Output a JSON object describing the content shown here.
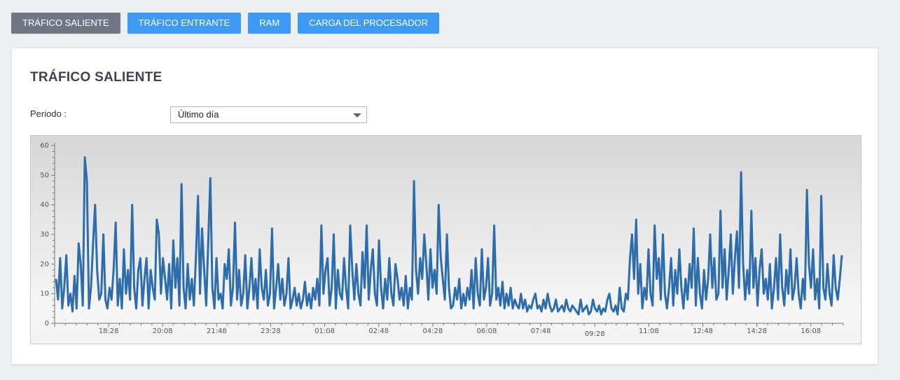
{
  "tabs": [
    {
      "label": "TRÁFICO SALIENTE",
      "active": true
    },
    {
      "label": "TRÁFICO ENTRANTE",
      "active": false
    },
    {
      "label": "RAM",
      "active": false
    },
    {
      "label": "CARGA DEL PROCESADOR",
      "active": false
    }
  ],
  "panel": {
    "title": "TRÁFICO SALIENTE",
    "period_label": "Periodo :",
    "period_value": "Último día"
  },
  "colors": {
    "accent": "#3d9bf5",
    "active_tab": "#6f7782",
    "series": "#2d6dab"
  },
  "chart_data": {
    "type": "line",
    "ylim": [
      0,
      60
    ],
    "yticks": [
      0,
      10,
      20,
      30,
      40,
      50,
      60
    ],
    "xlim": [
      0,
      1110
    ],
    "xticks": [
      {
        "label": "18:28",
        "t": 100
      },
      {
        "label": "20:08",
        "t": 200
      },
      {
        "label": "21:48",
        "t": 300
      },
      {
        "label": "23:28",
        "t": 400
      },
      {
        "label": "01:08",
        "t": 500
      },
      {
        "label": "02:48",
        "t": 600
      },
      {
        "label": "04:28",
        "t": 700
      },
      {
        "label": "06:08",
        "t": 800
      },
      {
        "label": "07:48",
        "t": 900
      },
      {
        "label": "09:28",
        "t": 1000
      },
      {
        "label": "11:08",
        "t": 1100
      },
      {
        "label": "12:48",
        "t": 1200
      },
      {
        "label": "14:28",
        "t": 1300
      },
      {
        "label": "16:08",
        "t": 1400
      }
    ],
    "grid": false,
    "series": [
      {
        "values": [
          15,
          8,
          22,
          5,
          12,
          23,
          6,
          10,
          4,
          16,
          5,
          27,
          20,
          6,
          56,
          48,
          5,
          12,
          27,
          40,
          18,
          8,
          10,
          30,
          8,
          5,
          12,
          8,
          18,
          34,
          6,
          15,
          5,
          25,
          10,
          18,
          8,
          40,
          12,
          5,
          18,
          22,
          6,
          15,
          22,
          5,
          18,
          12,
          8,
          35,
          30,
          10,
          22,
          15,
          8,
          20,
          5,
          28,
          12,
          22,
          6,
          47,
          12,
          5,
          20,
          8,
          15,
          6,
          22,
          43,
          10,
          32,
          18,
          6,
          28,
          49,
          12,
          5,
          22,
          8,
          10,
          5,
          20,
          15,
          25,
          6,
          12,
          34,
          8,
          18,
          6,
          10,
          23,
          5,
          12,
          22,
          8,
          15,
          5,
          25,
          12,
          8,
          18,
          6,
          10,
          32,
          5,
          12,
          20,
          8,
          15,
          6,
          10,
          22,
          5,
          8,
          12,
          6,
          10,
          5,
          8,
          14,
          6,
          10,
          5,
          12,
          8,
          15,
          6,
          33,
          10,
          18,
          22,
          6,
          12,
          30,
          5,
          18,
          10,
          8,
          22,
          12,
          5,
          33,
          18,
          8,
          20,
          10,
          6,
          24,
          12,
          33,
          8,
          18,
          25,
          10,
          6,
          28,
          12,
          5,
          15,
          8,
          22,
          10,
          6,
          20,
          15,
          8,
          12,
          6,
          16,
          5,
          12,
          8,
          48,
          18,
          10,
          22,
          15,
          30,
          20,
          8,
          25,
          12,
          18,
          10,
          40,
          22,
          15,
          8,
          30,
          12,
          5,
          6,
          12,
          8,
          15,
          5,
          10,
          6,
          12,
          8,
          18,
          5,
          22,
          10,
          6,
          25,
          8,
          12,
          22,
          6,
          10,
          33,
          8,
          12,
          6,
          14,
          5,
          10,
          6,
          12,
          5,
          8,
          6,
          5,
          10,
          5,
          8,
          4,
          6,
          5,
          8,
          10,
          5,
          6,
          4,
          8,
          5,
          10,
          6,
          4,
          5,
          8,
          4,
          5,
          6,
          4,
          8,
          5,
          4,
          6,
          5,
          4,
          3,
          8,
          4,
          5,
          6,
          3,
          4,
          8,
          5,
          4,
          6,
          3,
          5,
          4,
          8,
          10,
          5,
          4,
          6,
          3,
          12,
          5,
          4,
          10,
          8,
          22,
          30,
          15,
          35,
          10,
          20,
          5,
          12,
          8,
          25,
          10,
          6,
          33,
          15,
          22,
          8,
          30,
          10,
          5,
          12,
          22,
          6,
          18,
          10,
          25,
          12,
          5,
          15,
          8,
          20,
          12,
          32,
          6,
          22,
          10,
          5,
          18,
          8,
          15,
          30,
          12,
          22,
          8,
          10,
          38,
          12,
          25,
          8,
          18,
          30,
          10,
          22,
          31,
          12,
          51,
          20,
          8,
          18,
          10,
          38,
          12,
          22,
          6,
          18,
          25,
          10,
          15,
          8,
          20,
          5,
          12,
          22,
          8,
          30,
          12,
          6,
          18,
          10,
          25,
          8,
          12,
          22,
          10,
          5,
          15,
          8,
          45,
          20,
          12,
          25,
          8,
          15,
          5,
          43,
          12,
          8,
          20,
          10,
          6,
          23,
          12,
          8,
          15,
          23
        ]
      }
    ]
  }
}
